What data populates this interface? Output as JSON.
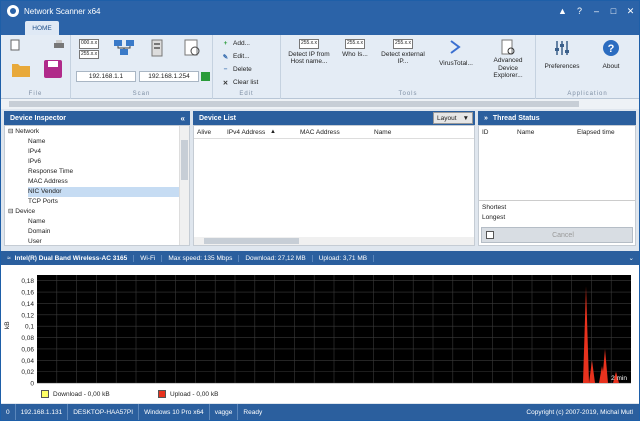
{
  "window": {
    "title": "Network Scanner x64"
  },
  "tabs": [
    {
      "label": "HOME"
    }
  ],
  "ribbon": {
    "group_labels": {
      "file": "File",
      "scan": "Scan",
      "edit": "Edit",
      "tools": "Tools",
      "application": "Application"
    },
    "ip_from": "192.168.1.1",
    "ip_to": "192.168.1.254",
    "edit_buttons": {
      "add": "Add...",
      "edit": "Edit...",
      "delete": "Delete",
      "clear": "Clear list"
    },
    "tools": {
      "detect_ip": "Detect IP from Host name...",
      "who_is": "Who Is...",
      "detect_external": "Detect external IP...",
      "virustotal": "VirusTotal...",
      "adv_explorer": "Advanced Device Explorer..."
    },
    "app": {
      "preferences": "Preferences",
      "about": "About"
    },
    "ip_icon_text": [
      "000.x.x",
      "255.x.x"
    ]
  },
  "inspector": {
    "title": "Device Inspector",
    "network_label": "Network",
    "network_items": [
      "Name",
      "IPv4",
      "IPv6",
      "Response Time",
      "MAC Address",
      "NIC Vendor",
      "TCP Ports"
    ],
    "selected_item": "NIC Vendor",
    "device_label": "Device",
    "device_items": [
      "Name",
      "Domain",
      "User"
    ]
  },
  "device_list": {
    "title": "Device List",
    "layout_label": "Layout",
    "columns": [
      "Alive",
      "IPv4 Address",
      "MAC Address",
      "Name"
    ]
  },
  "thread_status": {
    "title": "Thread Status",
    "columns": [
      "ID",
      "Name",
      "Elapsed time"
    ],
    "shortest": "Shortest",
    "longest": "Longest",
    "cancel": "Cancel"
  },
  "adapter_bar": {
    "name": "Intel(R) Dual Band Wireless-AC 3165",
    "type": "Wi-Fi",
    "max_speed": "Max speed: 135 Mbps",
    "download": "Download: 27,12 MB",
    "upload": "Upload: 3,71 MB"
  },
  "chart_data": {
    "type": "bar",
    "ylabel": "kB",
    "y_ticks": [
      "0,18",
      "0,16",
      "0,14",
      "0,12",
      "0,1",
      "0,08",
      "0,06",
      "0,04",
      "0,02",
      "0"
    ],
    "ylim": [
      0,
      0.19
    ],
    "time_label": "2 min",
    "series": [
      {
        "name": "Download - 0,00 kB",
        "color": "#ffff66",
        "values": []
      },
      {
        "name": "Upload - 0,00 kB",
        "color": "#e8321e",
        "values": [
          0.17,
          0.04,
          0.06,
          0.03,
          0.02
        ]
      }
    ],
    "grid": true,
    "background": "#000000"
  },
  "footer": {
    "count": "0",
    "ip": "192.168.1.131",
    "host": "DESKTOP-HAA57PI",
    "os": "Windows 10 Pro x64",
    "user": "vagge",
    "status": "Ready",
    "copyright": "Copyright (c) 2007-2019, Michal Mutl"
  },
  "colors": {
    "accent": "#2b5f9e",
    "upload": "#e8321e",
    "download": "#ffff66"
  }
}
